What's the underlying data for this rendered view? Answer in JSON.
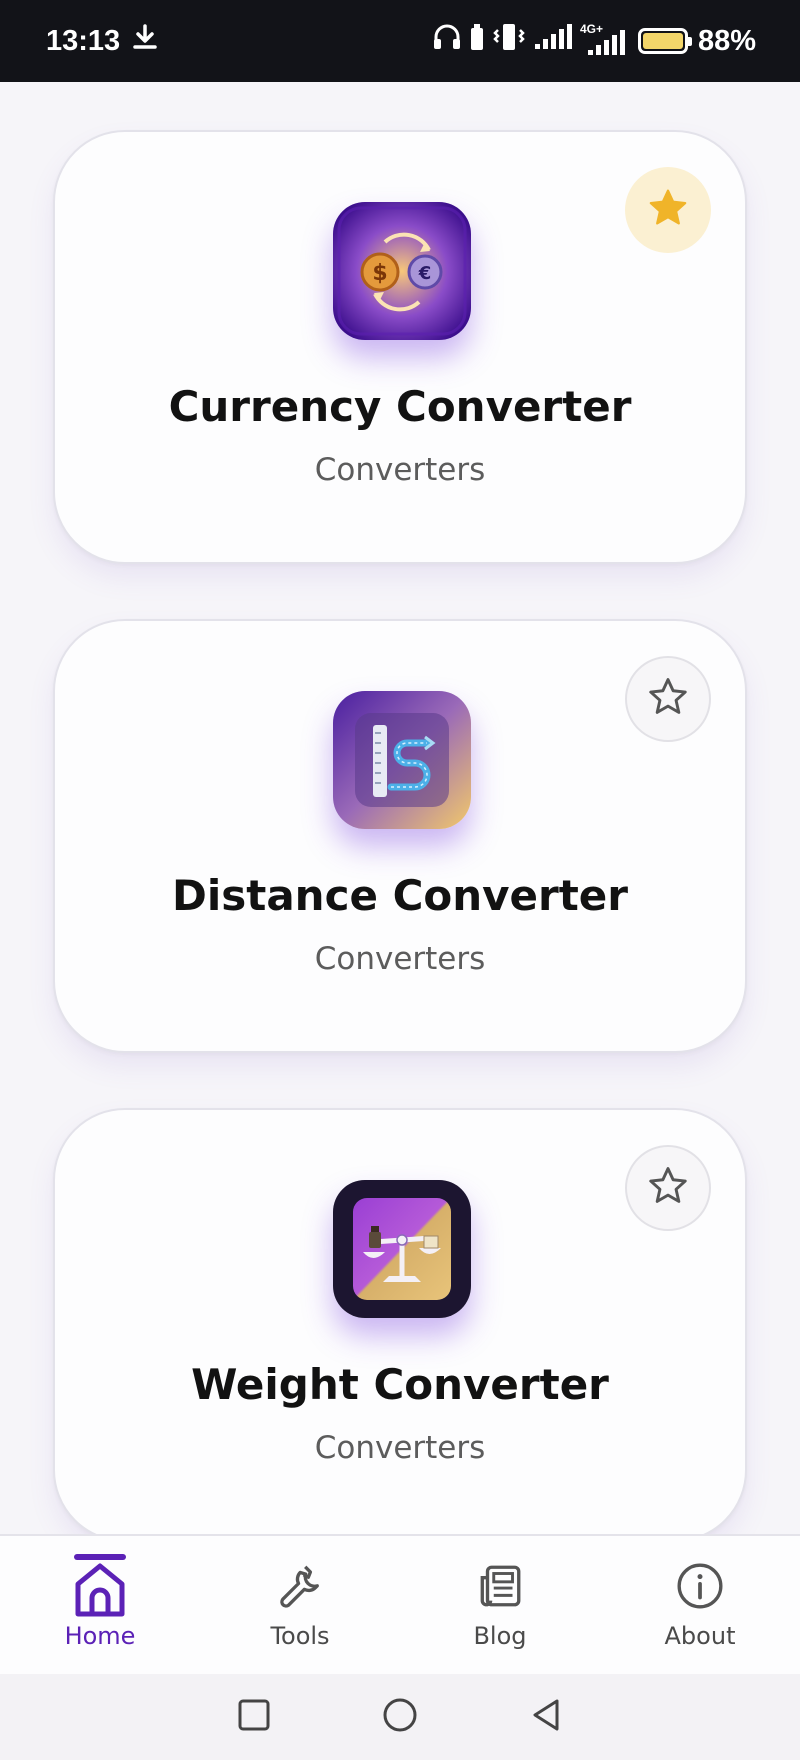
{
  "status_bar": {
    "time": "13:13",
    "battery": "88%",
    "network_label": "4G+"
  },
  "tools": [
    {
      "title": "Currency Converter",
      "category": "Converters",
      "favorited": true
    },
    {
      "title": "Distance Converter",
      "category": "Converters",
      "favorited": false
    },
    {
      "title": "Weight Converter",
      "category": "Converters",
      "favorited": false
    }
  ],
  "bottom_nav": {
    "items": [
      {
        "label": "Home",
        "icon": "home-icon",
        "active": true
      },
      {
        "label": "Tools",
        "icon": "wrench-icon",
        "active": false
      },
      {
        "label": "Blog",
        "icon": "newspaper-icon",
        "active": false
      },
      {
        "label": "About",
        "icon": "info-icon",
        "active": false
      }
    ]
  },
  "colors": {
    "accent": "#5b21b6",
    "star_active": "#f0b429",
    "card_border": "#e3e2ea"
  }
}
